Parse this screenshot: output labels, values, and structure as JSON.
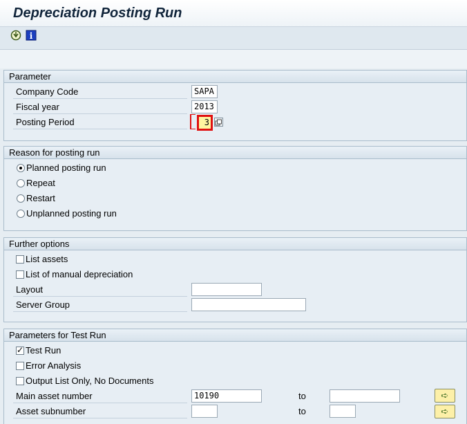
{
  "window": {
    "title": "Depreciation Posting Run"
  },
  "toolbar": {
    "icons": [
      "execute-icon",
      "info-icon"
    ],
    "info_glyph": "i"
  },
  "parameter": {
    "header": "Parameter",
    "company_code_label": "Company Code",
    "company_code_value": "SAPA",
    "fiscal_year_label": "Fiscal year",
    "fiscal_year_value": "2013",
    "posting_period_label": "Posting Period",
    "posting_period_value": "3"
  },
  "reason": {
    "header": "Reason for posting run",
    "options": [
      "Planned posting run",
      "Repeat",
      "Restart",
      "Unplanned posting run"
    ],
    "selected": "Planned posting run"
  },
  "further": {
    "header": "Further options",
    "list_assets_label": "List assets",
    "list_assets_checked": false,
    "manual_dep_label": "List of manual depreciation",
    "manual_dep_checked": false,
    "layout_label": "Layout",
    "layout_value": "",
    "server_group_label": "Server Group",
    "server_group_value": ""
  },
  "test_run": {
    "header": "Parameters for Test Run",
    "test_run_label": "Test Run",
    "test_run_checked": true,
    "error_analysis_label": "Error Analysis",
    "error_analysis_checked": false,
    "output_list_label": "Output List Only, No Documents",
    "output_list_checked": false,
    "main_asset_label": "Main asset number",
    "main_asset_from": "10190",
    "main_asset_to_label": "to",
    "main_asset_to": "",
    "sub_label": "Asset subnumber",
    "sub_from": "",
    "sub_to_label": "to",
    "sub_to": ""
  },
  "colors": {
    "focus_border": "#e01010",
    "focus_fill": "#fff5a0",
    "nav_button": "#fdf0a8"
  }
}
